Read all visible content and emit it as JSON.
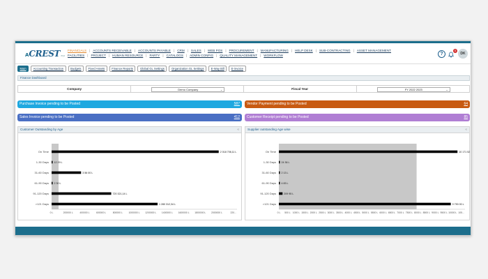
{
  "app": {
    "logo_text": "CREST",
    "logo_prefix": "A",
    "logo_tag": "erp"
  },
  "menu": {
    "row1": [
      "FINANCIALS",
      "ACCOUNTS RECEIVABLE",
      "ACCOUNTS PAYABLE",
      "CRM",
      "SALES",
      "WEB POS",
      "PROCUREMENT",
      "MANUFACTURING",
      "HELP DESK",
      "SUB-CONTRACTING",
      "ASSET MANAGEMENT"
    ],
    "row2": [
      "FACILITIES",
      "PROJECT",
      "HUMAN RESOURCE",
      "PARTY",
      "CATALOGS",
      "ADMIN CONFIG",
      "QUALITY MANAGEMENT",
      "WORKFLOW"
    ],
    "active": "FINANCIALS"
  },
  "header": {
    "help_icon": "help-circle-icon",
    "bell_icon": "bell-icon",
    "notification_count": "0",
    "avatar_initials": "DK"
  },
  "tabs": [
    "Main",
    "Accounting Transaction",
    "Budgets",
    "Fixed Assets",
    "Finance Reports",
    "Global GL Settings",
    "Organization GL Settings",
    "E-Way Bill",
    "E-invoice"
  ],
  "dashboard": {
    "title": "Finance Dashboard",
    "company_label": "Company",
    "company_value": "Demo Company",
    "fiscal_label": "Fiscal Year",
    "fiscal_value": "FY 2022 2023"
  },
  "cards": [
    {
      "label": "Purchase Invoice pending to be Posted",
      "count": "587",
      "color": "#1ea8e0"
    },
    {
      "label": "Vendor Payment pending to be Posted",
      "count": "64",
      "color": "#c85a12"
    },
    {
      "label": "Sales Invoice pending to be Posted",
      "count": "412",
      "color": "#4a6fc4"
    },
    {
      "label": "Customer Receipt pending to be Posted",
      "count": "85",
      "color": "#b07ed4"
    }
  ],
  "chart_data": [
    {
      "type": "bar",
      "orientation": "horizontal",
      "title": "Customer Outstanding by Age",
      "categories": [
        "On Time",
        "1-30 Days",
        "31-60 Days",
        "61-90 Days",
        "91-120 Days",
        ">121 Days"
      ],
      "values": [
        2018706,
        12290,
        356000,
        2300,
        720321,
        1280312
      ],
      "data_labels": [
        "2 018 706,11 L",
        "12 29 L",
        "3 56 00 L",
        "2 30 L",
        "720 321,14 L",
        "1 280 312,34 L"
      ],
      "xticks": [
        "0 L",
        "200000 L",
        "400000 L",
        "600000 L",
        "800000 L",
        "1000000 L",
        "1200000 L",
        "1400000 L",
        "1600000 L",
        "1800000 L",
        "2000000 L",
        "220..."
      ],
      "xlim": [
        0,
        2240000
      ],
      "bar_color": "#000000",
      "shaded_band_color": "#c8c8c8"
    },
    {
      "type": "bar",
      "orientation": "horizontal",
      "title": "Supplier outstanding Age wise",
      "categories": [
        "On Time",
        "1-30 Days",
        "31-60 Days",
        "61-90 Days",
        "91-120 Days",
        ">121 Days"
      ],
      "values": [
        10171520,
        2436,
        2130,
        4830,
        209950,
        9790000
      ],
      "data_labels": [
        "10 171 52 L",
        "24 36 L",
        "2 13 L",
        "4 83 L",
        "209 95 L",
        "9 790 00 L"
      ],
      "xticks": [
        "0 L",
        "500 L",
        "1000 L",
        "1500 L",
        "2000 L",
        "2500 L",
        "3000 L",
        "3500 L",
        "4000 L",
        "4500 L",
        "5000 L",
        "5500 L",
        "6000 L",
        "6500 L",
        "7000 L",
        "7500 L",
        "8000 L",
        "8500 L",
        "9000 L",
        "9500 L",
        "10000 L",
        "105..."
      ],
      "xlim": [
        0,
        10600000
      ],
      "bar_color": "#000000",
      "shaded_band_color": "#c8c8c8"
    }
  ]
}
